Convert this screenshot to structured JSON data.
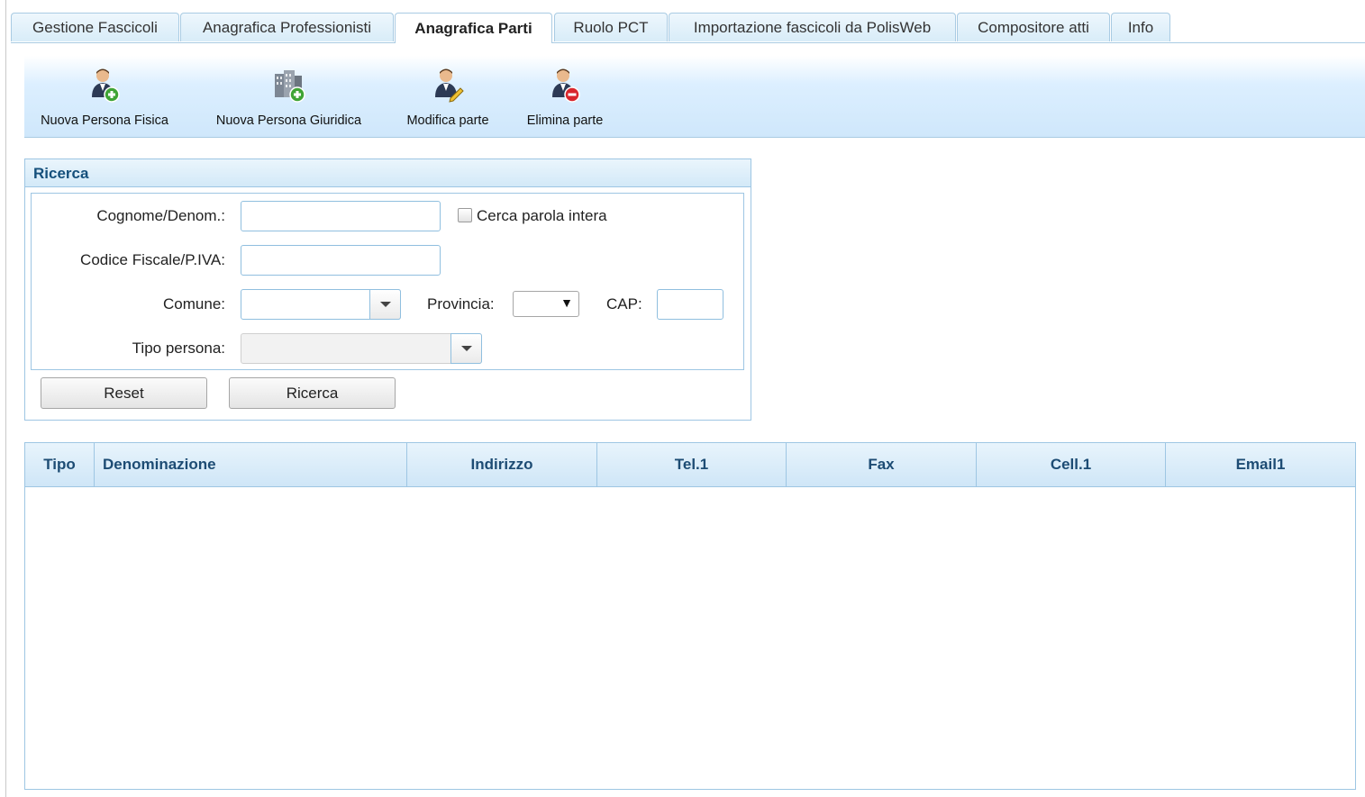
{
  "tabs": [
    {
      "label": "Gestione Fascicoli",
      "active": false
    },
    {
      "label": "Anagrafica Professionisti",
      "active": false
    },
    {
      "label": "Anagrafica Parti",
      "active": true
    },
    {
      "label": "Ruolo PCT",
      "active": false
    },
    {
      "label": "Importazione fascicoli da PolisWeb",
      "active": false
    },
    {
      "label": "Compositore atti",
      "active": false
    },
    {
      "label": "Info",
      "active": false
    }
  ],
  "toolbar": {
    "new_natural_person": {
      "label": "Nuova Persona Fisica",
      "icon": "person-add-icon"
    },
    "new_legal_person": {
      "label": "Nuova Persona Giuridica",
      "icon": "building-add-icon"
    },
    "edit_party": {
      "label": "Modifica parte",
      "icon": "person-edit-icon"
    },
    "delete_party": {
      "label": "Elimina parte",
      "icon": "person-remove-icon"
    }
  },
  "search": {
    "title": "Ricerca",
    "surname_label": "Cognome/Denom.:",
    "surname_value": "",
    "whole_word_label": "Cerca parola intera",
    "whole_word_checked": false,
    "tax_code_label": "Codice Fiscale/P.IVA:",
    "tax_code_value": "",
    "municipality_label": "Comune:",
    "municipality_value": "",
    "province_label": "Provincia:",
    "province_value": "",
    "zip_label": "CAP:",
    "zip_value": "",
    "person_type_label": "Tipo persona:",
    "person_type_value": "",
    "reset_label": "Reset",
    "search_label": "Ricerca"
  },
  "table": {
    "columns": [
      "Tipo",
      "Denominazione",
      "Indirizzo",
      "Tel.1",
      "Fax",
      "Cell.1",
      "Email1"
    ],
    "rows": []
  },
  "colors": {
    "accent_border": "#9ec6e3",
    "header_text": "#1d4c74",
    "panel_title": "#15507c"
  }
}
